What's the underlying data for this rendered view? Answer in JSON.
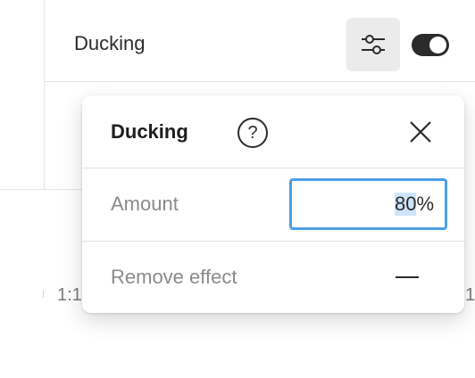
{
  "background": {
    "row_label": "Ducking",
    "toggle_state": "on",
    "timeline_left_label": "1:1",
    "timeline_right_label": "1"
  },
  "popover": {
    "title": "Ducking",
    "help_glyph": "?",
    "amount_label": "Amount",
    "amount_value_selected": "80",
    "amount_suffix": "%",
    "remove_label": "Remove effect"
  },
  "colors": {
    "accent_focus": "#4a9fe8",
    "selection": "#cfe3fa",
    "toggle_on": "#2b2b2b"
  },
  "icons": [
    "sliders-icon",
    "help-icon",
    "close-icon",
    "minus-icon"
  ]
}
